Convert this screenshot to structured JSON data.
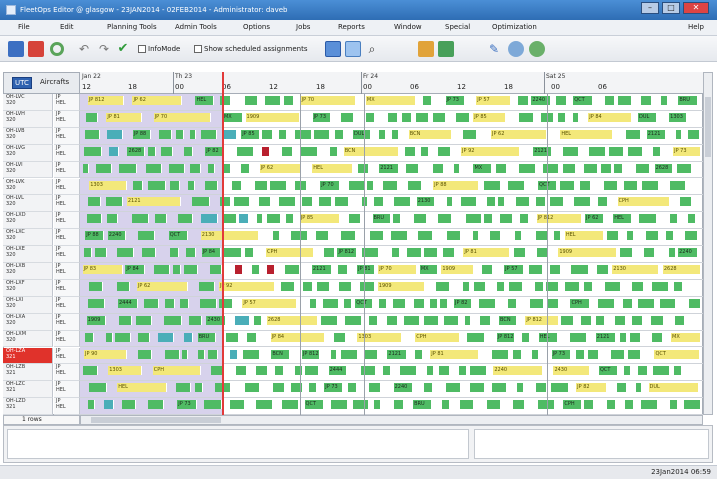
{
  "window": {
    "title": "FleetOps Editor @ glasgow - 23JAN2014 - 02FEB2014 - Administrator: daveb",
    "controls": {
      "minimize": "–",
      "maximize": "□",
      "close": "✕"
    }
  },
  "menu": [
    "File",
    "Edit",
    "Planning Tools",
    "Admin Tools",
    "Options",
    "Jobs",
    "Reports",
    "Window",
    "Special",
    "Optimization",
    "Help"
  ],
  "toolbar": {
    "infomode_label": "InfoMode",
    "show_scheduled_label": "Show scheduled assignments",
    "icons": [
      "save-icon",
      "save-as-icon",
      "refresh-icon",
      "undo-icon",
      "redo-icon",
      "check-icon",
      "view-grid-icon",
      "view-list-icon",
      "search-icon",
      "tools-icon",
      "chart-icon",
      "pencil-icon",
      "crew-icon",
      "crew-group-icon"
    ]
  },
  "gantt": {
    "utc_button": "UTC",
    "aircraft_header": "Aircrafts",
    "days": [
      {
        "label": "Jan 22",
        "x": 0
      },
      {
        "label": "Th 23",
        "x": 0
      },
      {
        "label": "Fr 24",
        "x": 0
      },
      {
        "label": "Sat 25",
        "x": 0
      }
    ],
    "hours": [
      "12",
      "18",
      "00",
      "06",
      "12",
      "18",
      "00",
      "06",
      "12",
      "18",
      "00",
      "06"
    ],
    "rows": [
      {
        "reg": "OH-LVC",
        "type": "JP",
        "sub": "320",
        "sub2": "HEL"
      },
      {
        "reg": "OH-LVH",
        "type": "JP",
        "sub": "320",
        "sub2": "HEL"
      },
      {
        "reg": "OH-LVB",
        "type": "JP",
        "sub": "320",
        "sub2": "HEL"
      },
      {
        "reg": "OH-LVG",
        "type": "JP",
        "sub": "320",
        "sub2": "HEL"
      },
      {
        "reg": "OH-LVI",
        "type": "JP",
        "sub": "320",
        "sub2": "HEL"
      },
      {
        "reg": "OH-LVK",
        "type": "JP",
        "sub": "320",
        "sub2": "HEL"
      },
      {
        "reg": "OH-LVL",
        "type": "JP",
        "sub": "320",
        "sub2": "HEL"
      },
      {
        "reg": "OH-LXD",
        "type": "JP",
        "sub": "320",
        "sub2": "HEL"
      },
      {
        "reg": "OH-LXC",
        "type": "JP",
        "sub": "320",
        "sub2": "HEL"
      },
      {
        "reg": "OH-LXE",
        "type": "JP",
        "sub": "320",
        "sub2": "HEL"
      },
      {
        "reg": "OH-LXB",
        "type": "JP",
        "sub": "320",
        "sub2": "HEL"
      },
      {
        "reg": "OH-LXF",
        "type": "JP",
        "sub": "320",
        "sub2": "HEL"
      },
      {
        "reg": "OH-LXI",
        "type": "JP",
        "sub": "320",
        "sub2": "HEL"
      },
      {
        "reg": "OH-LXA",
        "type": "JP",
        "sub": "320",
        "sub2": "HEL"
      },
      {
        "reg": "OH-LXM",
        "type": "JP",
        "sub": "320",
        "sub2": "HEL"
      },
      {
        "reg": "OH-LZA",
        "type": "JP",
        "sub": "321",
        "sub2": "HEL"
      },
      {
        "reg": "OH-LZB",
        "type": "JP",
        "sub": "321",
        "sub2": "HEL"
      },
      {
        "reg": "OH-LZC",
        "type": "JP",
        "sub": "321",
        "sub2": "HEL"
      },
      {
        "reg": "OH-LZD",
        "type": "JP",
        "sub": "321",
        "sub2": "HEL"
      }
    ],
    "flight_labels": [
      "JP 812",
      "JP 62",
      "HEL",
      "JP 92",
      "2121",
      "2444",
      "JP 81",
      "JP 70",
      "MX",
      "1909",
      "JP 73",
      "JP 57",
      "JP 88",
      "2240",
      "2430",
      "QCT",
      "2130",
      "2628",
      "JP 85",
      "JP 90",
      "BRU",
      "JP 82",
      "JP 83",
      "JP 84",
      "DUL",
      "1303",
      "CPH",
      "BCN"
    ],
    "status_text": "1 rows"
  },
  "statusbar": {
    "clock": "23Jan2014 06:59"
  },
  "colors": {
    "flight": "#4fbb64",
    "maintenance": "#f3e87a",
    "conflict": "#b8202e",
    "past": "#c9c3e6",
    "now_line": "#e23a3a"
  }
}
